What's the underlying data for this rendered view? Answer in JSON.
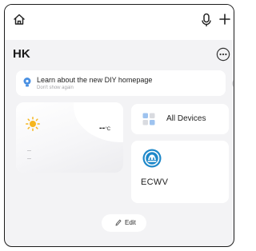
{
  "header": {
    "title": "HK"
  },
  "banner": {
    "title": "Learn about the new DIY homepage",
    "subtitle": "Don't show again"
  },
  "weather": {
    "temperature": "--",
    "unit": "°C",
    "rows": [
      "–",
      "–"
    ]
  },
  "all_devices": {
    "label": "All Devices"
  },
  "device": {
    "name": "ECWV"
  },
  "edit": {
    "label": "Edit"
  },
  "icons": {
    "home": "home-icon",
    "mic": "microphone-icon",
    "add": "plus-icon",
    "more": "more-icon",
    "bulb": "lightbulb-icon",
    "sun": "sun-icon",
    "grid": "grid-icon",
    "device": "device-icon",
    "pencil": "pencil-icon"
  },
  "colors": {
    "background": "#f3f3f5",
    "card": "#ffffff",
    "sun": "#f6b61e",
    "device_blue": "#1e88c9",
    "grid_blue": "#9ec3ef"
  }
}
